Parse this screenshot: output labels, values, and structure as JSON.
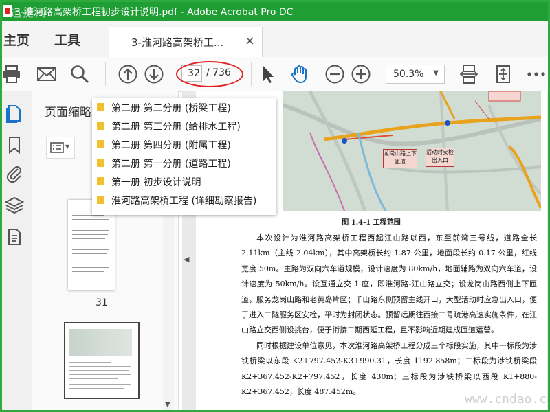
{
  "window": {
    "title": "3-淮河路高架桥工程初步设计说明.pdf - Adobe Acrobat Pro DC",
    "watermark_top": "迅捷网"
  },
  "tabs": {
    "home": "主页",
    "tools": "工具",
    "document": "3-淮河路高架桥工...",
    "close": "×"
  },
  "toolbar": {
    "current_page": "32",
    "total_pages": "/ 736",
    "zoom": "50.3%",
    "icons": [
      "print-icon",
      "email-icon",
      "search-icon",
      "page-up-icon",
      "page-down-icon",
      "select-cursor-icon",
      "hand-icon",
      "zoom-out-icon",
      "zoom-in-icon",
      "scroll-mode-icon",
      "fit-page-icon",
      "more-icon"
    ]
  },
  "left_panel": {
    "title": "页面缩略",
    "thumbnail_label": "31"
  },
  "bookmarks": [
    "第二册 第二分册 (桥梁工程)",
    "第二册 第三分册 (给排水工程)",
    "第二册 第四分册 (附属工程)",
    "第二册 第一分册 (道路工程)",
    "第一册 初步设计说明",
    "淮河路高架桥工程 (详细勘察报告)"
  ],
  "document": {
    "map_labels": {
      "label1": "龙岗山路上下匝道",
      "label2": "活动时安检出入口"
    },
    "caption": "图 1.4-1 工程范围",
    "paragraph1": "本次设计为淮河路高架桥工程西起江山路以西，东至前湾三号线，道路全长 2.11km（主线 2.04km），其中高架桥长约 1.87 公里，地面段长约 0.17 公里，红线宽度 50m。主路为双向六车道规模，设计速度为 80km/h，地面辅路为双向六车道，设计速度为 50km/h。设互通立交 1 座，即淮河路-江山路立交；设龙岗山路西侧上下匝道，服务龙岗山路和老黄岛片区；千山路东侧预留主线开口，大型活动时应急出入口，便于进入二隧服务区安检，平时为封闭状态。预留远期往西接二号疏港高速实施条件，在江山路立交西侧设挑台，便于衔接二期西延工程，且不影响近期建成匝道运营。",
    "paragraph2": "同时根据建设单位意见，本次淮河路高架桥工程分成三个标段实施，其中一标段为涉铁桥梁以东段 K2+797.452-K3+990.31，长度 1192.858m；二标段为涉铁桥梁段 K2+367.452-K2+797.452，长度 430m；三标段为涉铁桥梁以西段 K1+880-K2+367.452，长度 487.452m。"
  },
  "watermark_bottom": "www.cndao.com",
  "colors": {
    "titlebar": "#1f9e34",
    "accent_blue": "#1a73c8",
    "annotation_red": "#e02020",
    "folder": "#f2c02e"
  }
}
